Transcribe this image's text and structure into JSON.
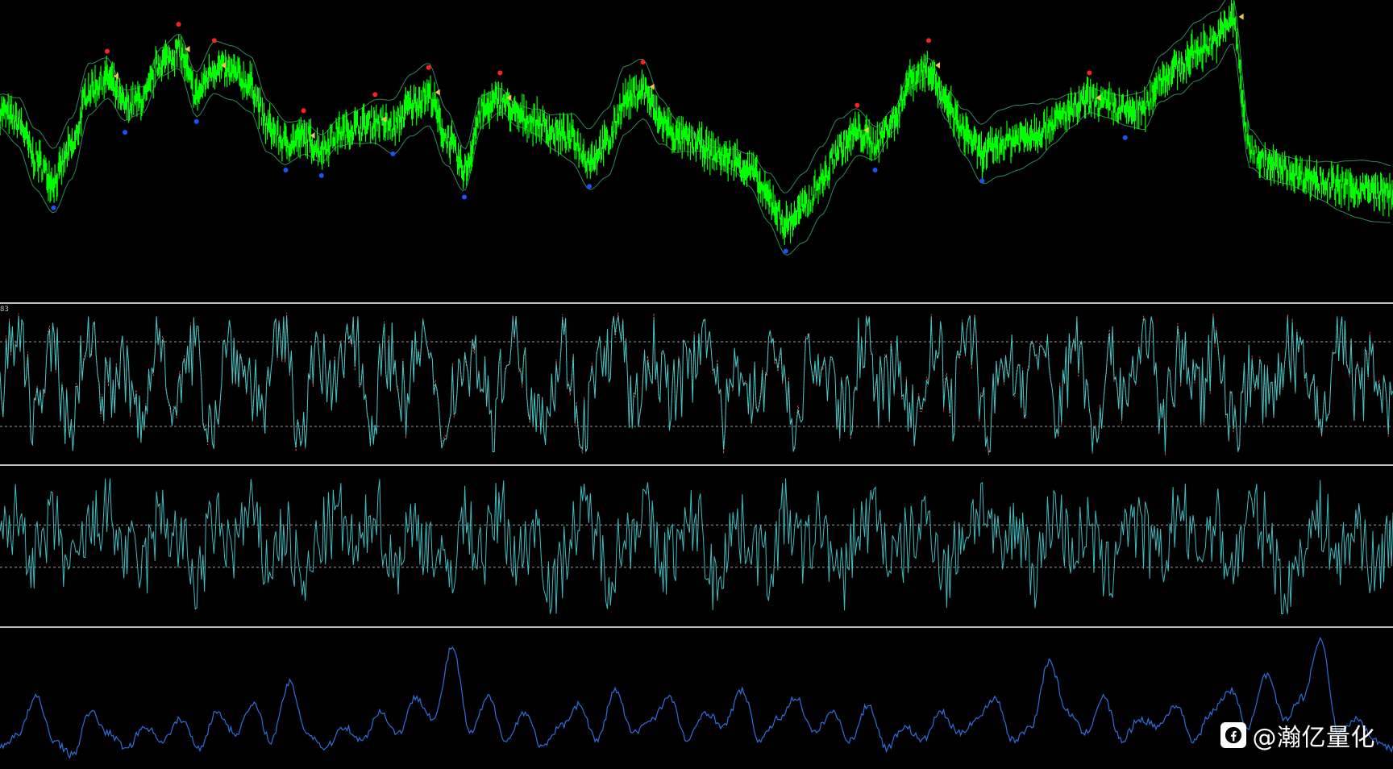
{
  "chart_data": [
    {
      "type": "line",
      "name_hint": "price",
      "grid": false,
      "legend": "none",
      "colors": {
        "price": "#00ff00",
        "bands": "#2e8b57",
        "buy_marker": "#1f4fff",
        "sell_marker": "#ff2020",
        "flag": "#f2c14e"
      },
      "ylim": [
        0,
        100
      ],
      "x": [
        0,
        20,
        40,
        60,
        80,
        100,
        120,
        140,
        160,
        180,
        200,
        220,
        240,
        260,
        280,
        300,
        320,
        340,
        360,
        380,
        400,
        420,
        440,
        460,
        480,
        500,
        520,
        540,
        560,
        580,
        600,
        620,
        640,
        660,
        680,
        700,
        720,
        740,
        760,
        780,
        800,
        820,
        840,
        860,
        880,
        900,
        920,
        940,
        960,
        980,
        1000,
        1020,
        1040,
        1060,
        1080,
        1100,
        1120,
        1140,
        1160,
        1180,
        1200,
        1220,
        1240,
        1260,
        1280,
        1300,
        1320,
        1340,
        1360,
        1380,
        1400,
        1420,
        1440,
        1460,
        1480,
        1500,
        1520,
        1540,
        1560
      ],
      "series": [
        {
          "values": [
            62,
            58,
            44,
            36,
            48,
            70,
            74,
            64,
            66,
            80,
            84,
            68,
            78,
            76,
            72,
            56,
            50,
            52,
            48,
            54,
            56,
            58,
            56,
            64,
            68,
            52,
            40,
            62,
            66,
            60,
            58,
            54,
            52,
            44,
            50,
            66,
            70,
            58,
            52,
            50,
            46,
            44,
            40,
            30,
            20,
            26,
            36,
            48,
            54,
            50,
            58,
            74,
            78,
            64,
            54,
            46,
            50,
            52,
            54,
            58,
            62,
            66,
            64,
            62,
            62,
            74,
            78,
            84,
            88,
            96,
            48,
            42,
            40,
            38,
            36,
            34,
            33,
            32,
            31
          ]
        }
      ]
    },
    {
      "type": "line",
      "name_hint": "oscillator-1",
      "ylim": [
        0,
        100
      ],
      "levels": [
        80,
        20
      ],
      "colors": {
        "line": "#40c8c8",
        "signal": "#ff6a6a",
        "level": "#9a9a9a"
      },
      "grid": false,
      "series": [
        {
          "values": [
            50,
            82,
            30,
            70,
            20,
            90,
            44,
            60,
            18,
            86,
            36,
            72,
            24,
            80,
            55,
            35,
            88,
            22,
            64,
            46,
            92,
            28,
            74,
            40,
            84,
            16,
            58,
            68,
            26,
            90,
            48,
            34,
            78,
            20,
            62,
            86,
            30,
            72,
            44,
            56,
            94,
            22,
            66,
            38,
            82,
            18,
            70,
            52,
            28,
            88,
            42,
            60,
            24,
            80,
            36,
            92,
            20,
            68,
            50,
            76,
            30,
            84,
            22,
            64,
            46,
            90,
            26,
            72,
            40,
            86,
            18,
            60,
            34,
            80,
            54,
            28,
            88,
            44,
            66,
            24
          ]
        }
      ]
    },
    {
      "type": "line",
      "name_hint": "oscillator-2",
      "ylim": [
        -100,
        100
      ],
      "levels": [
        30,
        -30
      ],
      "colors": {
        "line": "#3fbcc0",
        "level": "#9a9a9a"
      },
      "grid": false,
      "series": [
        {
          "values": [
            10,
            40,
            -20,
            30,
            -40,
            20,
            50,
            -10,
            -30,
            40,
            10,
            -50,
            30,
            0,
            45,
            -25,
            20,
            -60,
            15,
            40,
            -15,
            60,
            -30,
            25,
            10,
            -45,
            35,
            -10,
            50,
            -20,
            30,
            -65,
            20,
            45,
            -35,
            10,
            55,
            -20,
            0,
            40,
            -50,
            25,
            15,
            -30,
            45,
            -10,
            35,
            -55,
            20,
            50,
            -25,
            10,
            40,
            -40,
            25,
            60,
            -15,
            30,
            -35,
            50,
            0,
            20,
            -45,
            40,
            15,
            -25,
            55,
            -10,
            35,
            -30,
            45,
            20,
            -80,
            10,
            40,
            -20,
            30,
            -35,
            25
          ]
        }
      ]
    },
    {
      "type": "line",
      "name_hint": "volatility",
      "ylim": [
        0,
        100
      ],
      "colors": {
        "line": "#2f6fe0"
      },
      "grid": false,
      "series": [
        {
          "values": [
            20,
            30,
            55,
            25,
            15,
            45,
            30,
            20,
            35,
            25,
            40,
            20,
            45,
            30,
            50,
            25,
            65,
            30,
            20,
            35,
            25,
            45,
            30,
            55,
            40,
            90,
            30,
            55,
            25,
            45,
            20,
            35,
            50,
            25,
            60,
            30,
            40,
            55,
            25,
            45,
            35,
            60,
            25,
            40,
            55,
            30,
            45,
            25,
            50,
            20,
            35,
            25,
            45,
            30,
            40,
            55,
            25,
            35,
            80,
            45,
            30,
            55,
            25,
            40,
            35,
            50,
            25,
            45,
            60,
            35,
            70,
            40,
            55,
            95,
            30,
            40,
            25,
            20
          ]
        }
      ]
    }
  ],
  "panes": {
    "osc1_label": "83"
  },
  "watermark": {
    "text": "@瀚亿量化",
    "icon": "facebook-style-logo"
  }
}
